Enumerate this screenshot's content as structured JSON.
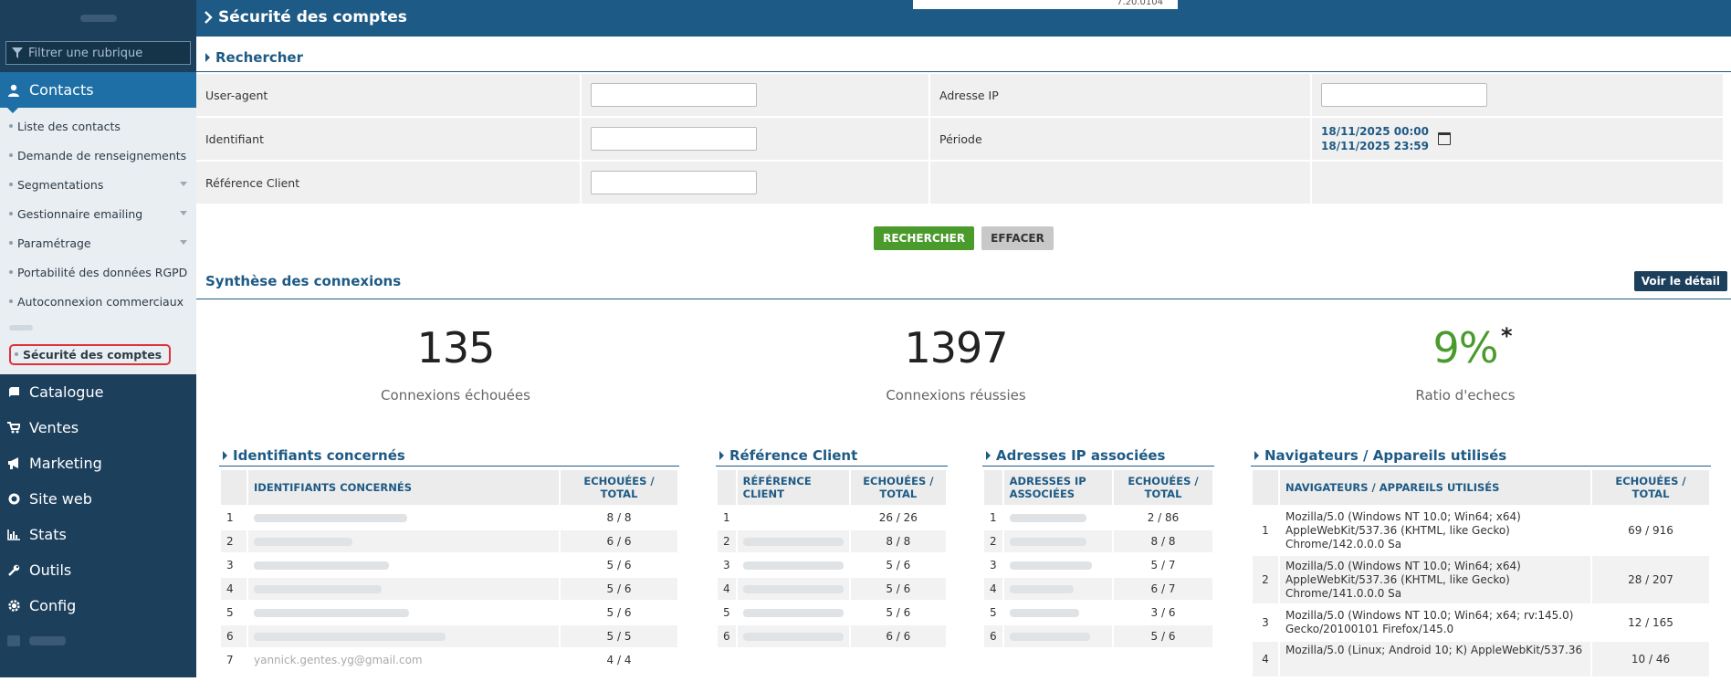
{
  "sidebar": {
    "filter_placeholder": "Filtrer une rubrique",
    "active_section": "Contacts",
    "sub_items": [
      {
        "label": "Liste des contacts",
        "caret": false
      },
      {
        "label": "Demande de renseignements",
        "caret": false
      },
      {
        "label": "Segmentations",
        "caret": true
      },
      {
        "label": "Gestionnaire emailing",
        "caret": true
      },
      {
        "label": "Paramétrage",
        "caret": true
      },
      {
        "label": "Portabilité des données RGPD",
        "caret": false
      },
      {
        "label": "Autoconnexion commerciaux",
        "caret": false
      }
    ],
    "selected_item": "Sécurité des comptes",
    "sections": [
      {
        "label": "Catalogue",
        "icon": "book-icon"
      },
      {
        "label": "Ventes",
        "icon": "cart-icon"
      },
      {
        "label": "Marketing",
        "icon": "megaphone-icon"
      },
      {
        "label": "Site web",
        "icon": "globe-icon"
      },
      {
        "label": "Stats",
        "icon": "bar-chart-icon"
      },
      {
        "label": "Outils",
        "icon": "wrench-icon"
      },
      {
        "label": "Config",
        "icon": "gear-icon"
      }
    ]
  },
  "header": {
    "title": "Sécurité des comptes",
    "version": "7.20.0104"
  },
  "search": {
    "title": "Rechercher",
    "useragent_label": "User-agent",
    "ip_label": "Adresse IP",
    "identifiant_label": "Identifiant",
    "periode_label": "Période",
    "periode_start": "18/11/2025 00:00",
    "periode_end": "18/11/2025 23:59",
    "ref_client_label": "Référence Client",
    "search_button": "RECHERCHER",
    "clear_button": "EFFACER"
  },
  "synthese": {
    "title": "Synthèse des connexions",
    "detail_button": "Voir le détail",
    "failed_value": "135",
    "failed_label": "Connexions échouées",
    "success_value": "1397",
    "success_label": "Connexions réussies",
    "ratio_value": "9%",
    "ratio_star": "*",
    "ratio_label": "Ratio d'echecs"
  },
  "tables": {
    "ident": {
      "title": "Identifiants concernés",
      "col1": "IDENTIFIANTS CONCERNÉS",
      "col2": "ECHOUÉES / TOTAL",
      "rows": [
        {
          "n": "1",
          "v": "8 / 8"
        },
        {
          "n": "2",
          "v": "6 / 6"
        },
        {
          "n": "3",
          "v": "5 / 6"
        },
        {
          "n": "4",
          "v": "5 / 6"
        },
        {
          "n": "5",
          "v": "5 / 6"
        },
        {
          "n": "6",
          "v": "5 / 5"
        },
        {
          "n": "7",
          "v": "4 / 4",
          "id": "yannick.gentes.yg@gmail.com"
        }
      ]
    },
    "ref": {
      "title": "Référence Client",
      "col1": "RÉFÉRENCE CLIENT",
      "col2": "ECHOUÉES / TOTAL",
      "rows": [
        {
          "n": "1",
          "v": "26 / 26"
        },
        {
          "n": "2",
          "v": "8 / 8"
        },
        {
          "n": "3",
          "v": "5 / 6"
        },
        {
          "n": "4",
          "v": "5 / 6"
        },
        {
          "n": "5",
          "v": "5 / 6"
        },
        {
          "n": "6",
          "v": "6 / 6"
        }
      ]
    },
    "ip": {
      "title": "Adresses IP associées",
      "col1": "ADRESSES IP ASSOCIÉES",
      "col2": "ECHOUÉES / TOTAL",
      "rows": [
        {
          "n": "1",
          "v": "2 / 86"
        },
        {
          "n": "2",
          "v": "8 / 8"
        },
        {
          "n": "3",
          "v": "5 / 7"
        },
        {
          "n": "4",
          "v": "6 / 7"
        },
        {
          "n": "5",
          "v": "3 / 6"
        },
        {
          "n": "6",
          "v": "5 / 6"
        }
      ]
    },
    "nav": {
      "title": "Navigateurs / Appareils utilisés",
      "col1": "NAVIGATEURS / APPAREILS UTILISÉS",
      "col2": "ECHOUÉES / TOTAL",
      "rows": [
        {
          "n": "1",
          "ua": "Mozilla/5.0 (Windows NT 10.0; Win64; x64) AppleWebKit/537.36 (KHTML, like Gecko) Chrome/142.0.0.0 Sa",
          "v": "69 / 916"
        },
        {
          "n": "2",
          "ua": "Mozilla/5.0 (Windows NT 10.0; Win64; x64) AppleWebKit/537.36 (KHTML, like Gecko) Chrome/141.0.0.0 Sa",
          "v": "28 / 207"
        },
        {
          "n": "3",
          "ua": "Mozilla/5.0 (Windows NT 10.0; Win64; x64; rv:145.0) Gecko/20100101 Firefox/145.0",
          "v": "12 / 165"
        },
        {
          "n": "4",
          "ua": "Mozilla/5.0 (Linux; Android 10; K) AppleWebKit/537.36",
          "v": "10 / 46"
        }
      ]
    }
  }
}
